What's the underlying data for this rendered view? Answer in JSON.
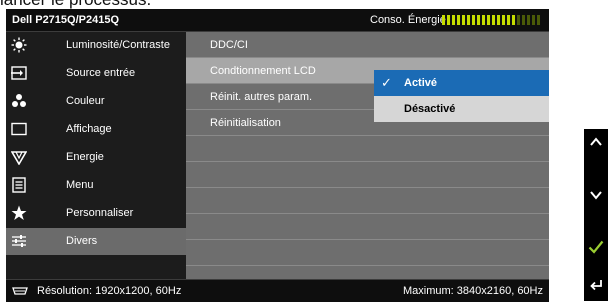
{
  "banner": {
    "text": "lancer le processus."
  },
  "title_bar": {
    "model": "Dell P2715Q/P2415Q",
    "energy_label": "Conso. Énergie",
    "energy_level_fraction": 0.74,
    "energy_color": "#c6dd00"
  },
  "left_menu": {
    "items": [
      {
        "label": "Luminosité/Contraste",
        "icon": "brightness-icon"
      },
      {
        "label": "Source entrée",
        "icon": "input-source-icon"
      },
      {
        "label": "Couleur",
        "icon": "color-icon"
      },
      {
        "label": "Affichage",
        "icon": "display-icon"
      },
      {
        "label": "Energie",
        "icon": "energy-icon"
      },
      {
        "label": "Menu",
        "icon": "menu-icon"
      },
      {
        "label": "Personnaliser",
        "icon": "star-icon"
      },
      {
        "label": "Divers",
        "icon": "others-icon"
      }
    ],
    "selected": "Divers"
  },
  "submenu": {
    "items": [
      {
        "label": "DDC/CI"
      },
      {
        "label": "Condtionnement LCD"
      },
      {
        "label": "Réinit. autres param."
      },
      {
        "label": "Réinitialisation"
      }
    ],
    "selected": "Condtionnement LCD"
  },
  "options": {
    "active_label": "Activé",
    "inactive_label": "Désactivé",
    "selected": "Activé",
    "accent_color": "#1b6bb5"
  },
  "status_bar": {
    "resolution": "Résolution: 1920x1200, 60Hz",
    "maximum": "Maximum: 3840x2160, 60Hz"
  },
  "side_buttons": [
    {
      "icon": "chevron-up-icon"
    },
    {
      "icon": "chevron-down-icon"
    },
    {
      "icon": "check-icon",
      "color": "#9acd32"
    },
    {
      "icon": "back-icon"
    }
  ]
}
